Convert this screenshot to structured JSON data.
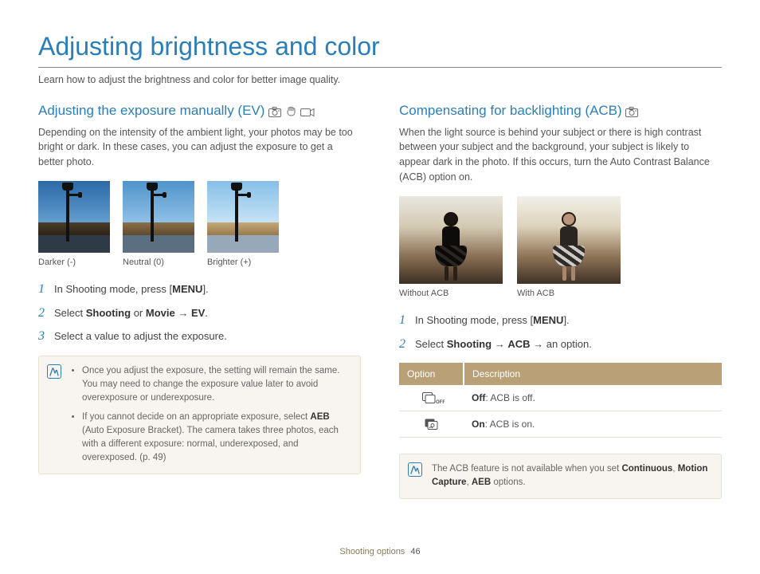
{
  "page_title": "Adjusting brightness and color",
  "page_subtitle": "Learn how to adjust the brightness and color for better image quality.",
  "footer_section": "Shooting options",
  "page_number": "46",
  "left": {
    "heading": "Adjusting the exposure manually (EV)",
    "body": "Depending on the intensity of the ambient light, your photos may be too bright or dark. In these cases, you can adjust the exposure to get a better photo.",
    "captions": [
      "Darker (-)",
      "Neutral (0)",
      "Brighter (+)"
    ],
    "step1_pre": "In Shooting mode, press [",
    "step1_btn": "MENU",
    "step1_post": "].",
    "step2_pre": "Select ",
    "step2_b1": "Shooting",
    "step2_or": " or ",
    "step2_b2": "Movie",
    "step2_arrow": " → ",
    "step2_b3": "EV",
    "step2_post": ".",
    "step3": "Select a value to adjust the exposure.",
    "note_items": [
      "Once you adjust the exposure, the setting will remain the same. You may need to change the exposure value later to avoid overexposure or underexposure.",
      "If you cannot decide on an appropriate exposure, select AEB (Auto Exposure Bracket). The camera takes three photos, each with a different exposure: normal, underexposed, and overexposed. (p. 49)"
    ],
    "note_bold_word": "AEB"
  },
  "right": {
    "heading": "Compensating for backlighting (ACB)",
    "body": "When the light source is behind your subject or there is high contrast between your subject and the background, your subject is likely to appear dark in the photo. If this occurs, turn the Auto Contrast Balance (ACB) option on.",
    "captions": [
      "Without ACB",
      "With ACB"
    ],
    "step1_pre": "In Shooting mode, press [",
    "step1_btn": "MENU",
    "step1_post": "].",
    "step2_pre": "Select ",
    "step2_b1": "Shooting",
    "step2_arrow1": " → ",
    "step2_b2": "ACB",
    "step2_arrow2": " → an option.",
    "table": {
      "head_option": "Option",
      "head_desc": "Description",
      "rows": [
        {
          "label": "Off",
          "desc": ": ACB is off."
        },
        {
          "label": "On",
          "desc": ": ACB is on."
        }
      ]
    },
    "note_pre": "The ACB feature is not available when you set ",
    "note_b1": "Continuous",
    "note_mid1": ", ",
    "note_b2": "Motion Capture",
    "note_mid2": ", ",
    "note_b3": "AEB",
    "note_post": " options."
  }
}
